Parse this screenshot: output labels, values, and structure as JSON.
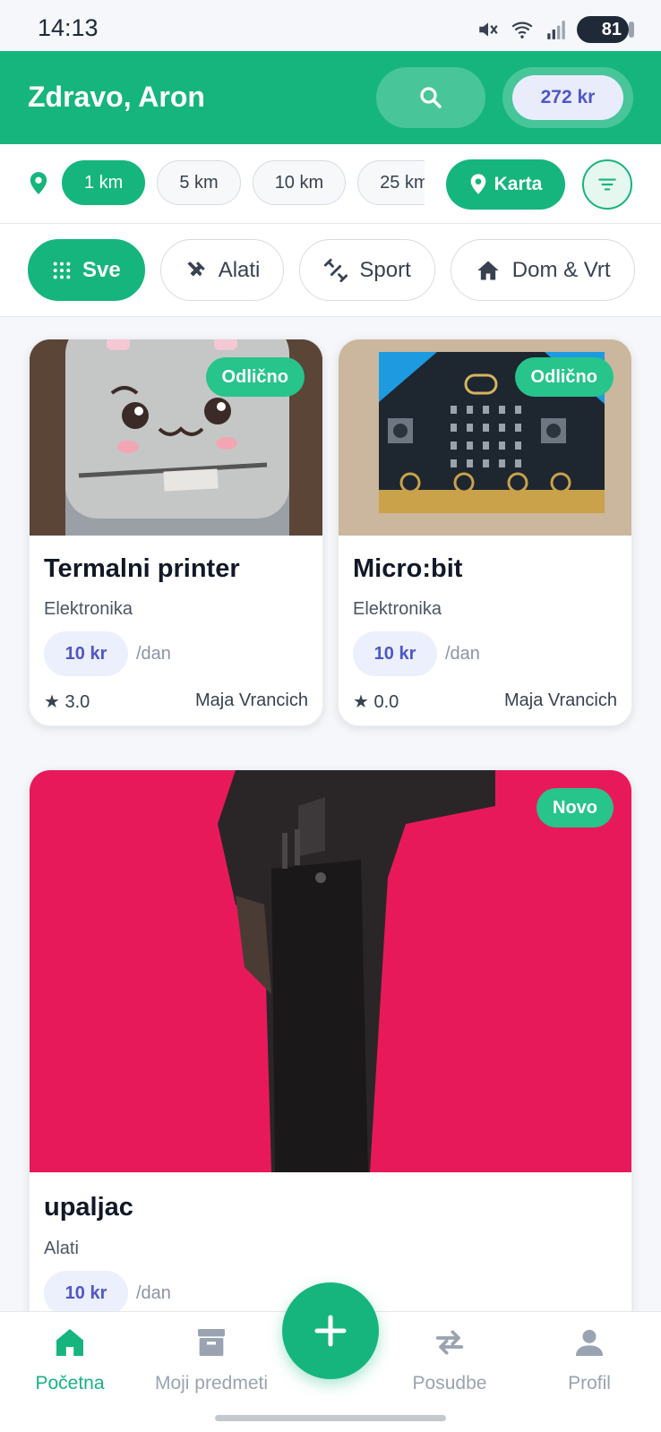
{
  "status_bar": {
    "time": "14:13",
    "battery": "81"
  },
  "header": {
    "greeting": "Zdravo, Aron",
    "balance": "272 kr"
  },
  "distance_filter": {
    "options": [
      "1 km",
      "5 km",
      "10 km",
      "25 km"
    ],
    "selected": "1 km",
    "map_label": "Karta"
  },
  "categories": {
    "items": [
      "Sve",
      "Alati",
      "Sport",
      "Dom & Vrt"
    ],
    "selected": "Sve"
  },
  "listings": [
    {
      "title": "Termalni printer",
      "category": "Elektronika",
      "badge": "Odlično",
      "price": "10 kr",
      "unit": "/dan",
      "rating": "★ 3.0",
      "owner": "Maja Vrancich"
    },
    {
      "title": "Micro:bit",
      "category": "Elektronika",
      "badge": "Odlično",
      "price": "10 kr",
      "unit": "/dan",
      "rating": "★ 0.0",
      "owner": "Maja Vrancich"
    },
    {
      "title": "upaljac",
      "category": "Alati",
      "badge": "Novo",
      "price": "10 kr",
      "unit": "/dan"
    }
  ],
  "bottom_nav": {
    "items": [
      "Početna",
      "Moji predmeti",
      "Posudbe",
      "Profil"
    ],
    "selected": "Početna"
  },
  "colors": {
    "primary": "#16b57e",
    "accent": "#4f57c4",
    "badge": "#27c48b"
  }
}
